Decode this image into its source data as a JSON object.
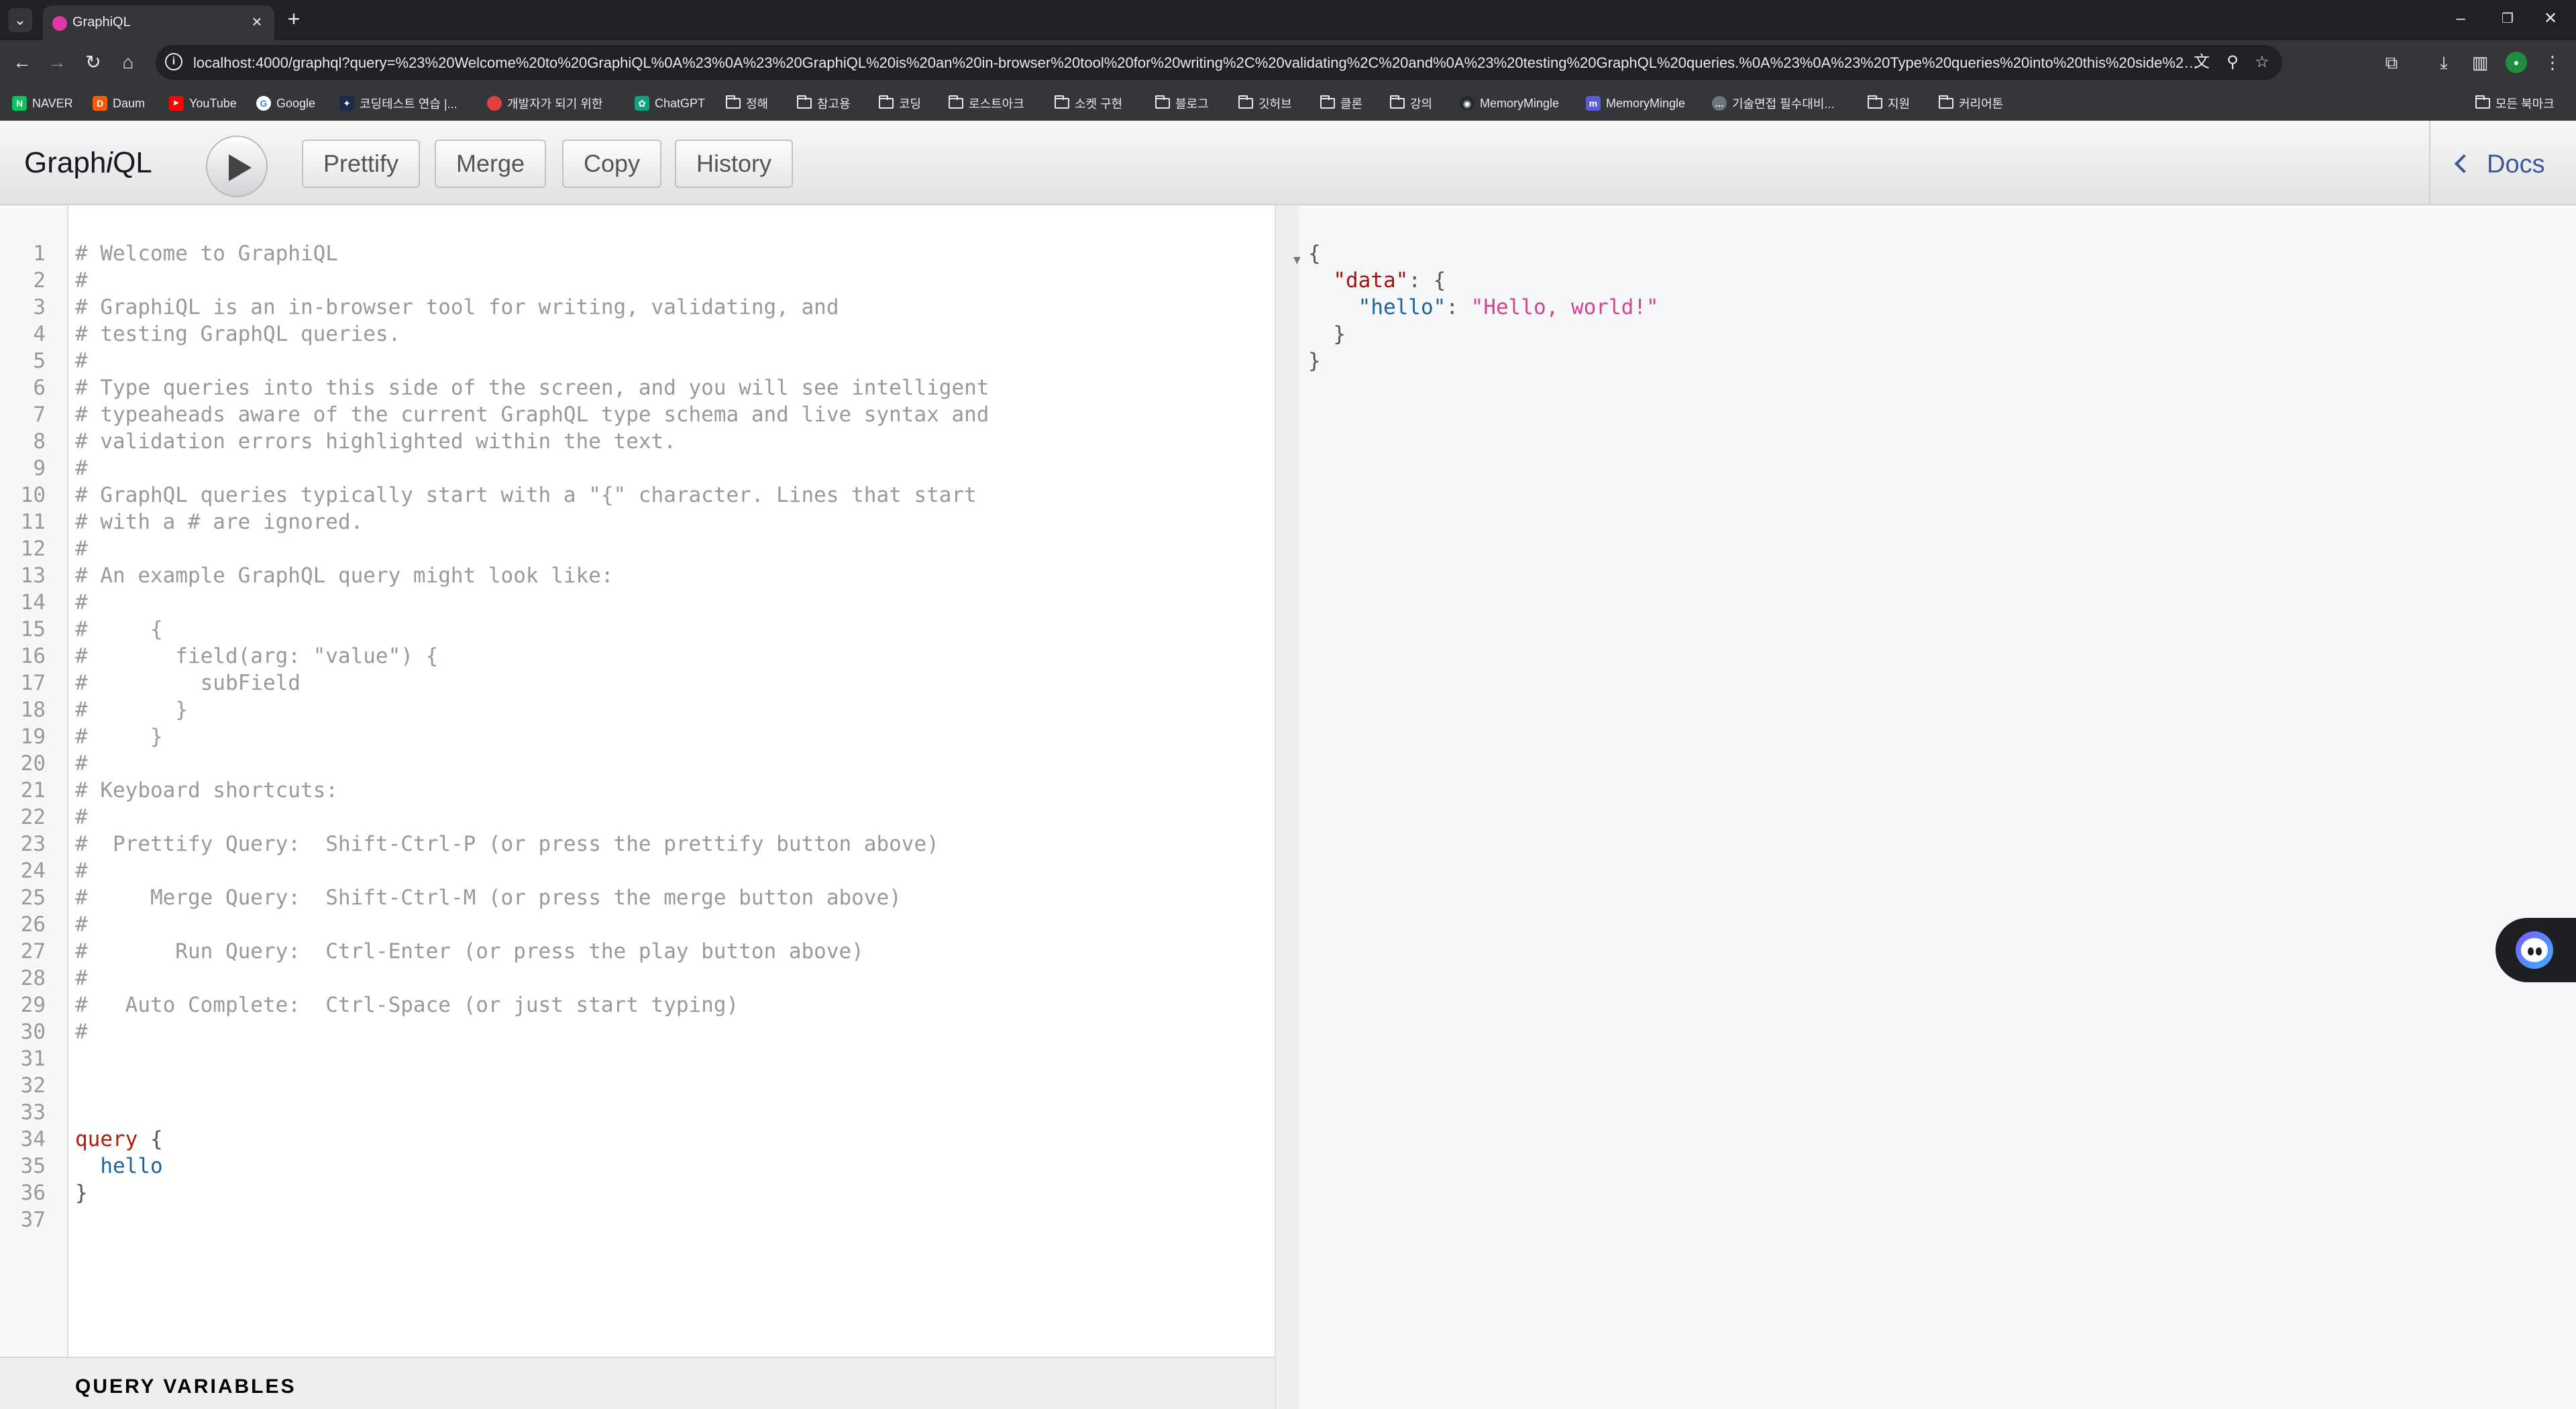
{
  "browser": {
    "tab": {
      "title": "GraphiQL"
    },
    "url": "localhost:4000/graphql?query=%23%20Welcome%20to%20GraphiQL%0A%23%0A%23%20GraphiQL%20is%20an%20in-browser%20tool%20for%20writing%2C%20validating%2C%20and%0A%23%20testing%20GraphQL%20queries.%0A%23%0A%23%20Type%20queries%20into%20this%20side%20of%20the%20screen%2C...",
    "bookmarks": [
      {
        "label": "NAVER",
        "icon": "naver-icon",
        "color": "#03c75a"
      },
      {
        "label": "Daum",
        "icon": "daum-icon",
        "color": "#ff5a00"
      },
      {
        "label": "YouTube",
        "icon": "youtube-icon",
        "color": "#ff0000"
      },
      {
        "label": "Google",
        "icon": "google-icon",
        "color": "#4285f4"
      },
      {
        "label": "코딩테스트 연습 |...",
        "icon": "programmers-icon",
        "color": "#1e2a4a"
      },
      {
        "label": "개발자가 되기 위한",
        "icon": "site-icon",
        "color": "#e04040"
      },
      {
        "label": "ChatGPT",
        "icon": "chatgpt-icon",
        "color": "#10a37f"
      },
      {
        "label": "정해",
        "icon": "folder-icon"
      },
      {
        "label": "참고용",
        "icon": "folder-icon"
      },
      {
        "label": "코딩",
        "icon": "folder-icon"
      },
      {
        "label": "로스트아크",
        "icon": "folder-icon"
      },
      {
        "label": "소켓 구현",
        "icon": "folder-icon"
      },
      {
        "label": "블로그",
        "icon": "folder-icon"
      },
      {
        "label": "깃허브",
        "icon": "folder-icon"
      },
      {
        "label": "클론",
        "icon": "folder-icon"
      },
      {
        "label": "강의",
        "icon": "folder-icon"
      },
      {
        "label": "MemoryMingle",
        "icon": "github-icon",
        "color": "#24292e"
      },
      {
        "label": "MemoryMingle",
        "icon": "site-icon",
        "color": "#5b5bd6"
      },
      {
        "label": "기술면접 필수대비...",
        "icon": "chat-icon",
        "color": "#6e7681"
      },
      {
        "label": "지원",
        "icon": "folder-icon"
      },
      {
        "label": "커리어톤",
        "icon": "folder-icon"
      }
    ],
    "all_bookmarks": "모든 북마크"
  },
  "graphiql": {
    "title_prefix": "Graph",
    "title_italic": "i",
    "title_suffix": "QL",
    "buttons": {
      "prettify": "Prettify",
      "merge": "Merge",
      "copy": "Copy",
      "history": "History"
    },
    "docs": "Docs",
    "query_variables": "QUERY VARIABLES",
    "editor_lines": [
      {
        "t": "# Welcome to GraphiQL",
        "k": "comment"
      },
      {
        "t": "#",
        "k": "comment"
      },
      {
        "t": "# GraphiQL is an in-browser tool for writing, validating, and",
        "k": "comment"
      },
      {
        "t": "# testing GraphQL queries.",
        "k": "comment"
      },
      {
        "t": "#",
        "k": "comment"
      },
      {
        "t": "# Type queries into this side of the screen, and you will see intelligent",
        "k": "comment"
      },
      {
        "t": "# typeaheads aware of the current GraphQL type schema and live syntax and",
        "k": "comment"
      },
      {
        "t": "# validation errors highlighted within the text.",
        "k": "comment"
      },
      {
        "t": "#",
        "k": "comment"
      },
      {
        "t": "# GraphQL queries typically start with a \"{\" character. Lines that start",
        "k": "comment"
      },
      {
        "t": "# with a # are ignored.",
        "k": "comment"
      },
      {
        "t": "#",
        "k": "comment"
      },
      {
        "t": "# An example GraphQL query might look like:",
        "k": "comment"
      },
      {
        "t": "#",
        "k": "comment"
      },
      {
        "t": "#     {",
        "k": "comment"
      },
      {
        "t": "#       field(arg: \"value\") {",
        "k": "comment"
      },
      {
        "t": "#         subField",
        "k": "comment"
      },
      {
        "t": "#       }",
        "k": "comment"
      },
      {
        "t": "#     }",
        "k": "comment"
      },
      {
        "t": "#",
        "k": "comment"
      },
      {
        "t": "# Keyboard shortcuts:",
        "k": "comment"
      },
      {
        "t": "#",
        "k": "comment"
      },
      {
        "t": "#  Prettify Query:  Shift-Ctrl-P (or press the prettify button above)",
        "k": "comment"
      },
      {
        "t": "#",
        "k": "comment"
      },
      {
        "t": "#     Merge Query:  Shift-Ctrl-M (or press the merge button above)",
        "k": "comment"
      },
      {
        "t": "#",
        "k": "comment"
      },
      {
        "t": "#       Run Query:  Ctrl-Enter (or press the play button above)",
        "k": "comment"
      },
      {
        "t": "#",
        "k": "comment"
      },
      {
        "t": "#   Auto Complete:  Ctrl-Space (or just start typing)",
        "k": "comment"
      },
      {
        "t": "#",
        "k": "comment"
      },
      {
        "t": "",
        "k": "plain"
      },
      {
        "t": "",
        "k": "plain"
      },
      {
        "t": "",
        "k": "plain"
      },
      {
        "t": "query {",
        "k": "query"
      },
      {
        "t": "  hello",
        "k": "field"
      },
      {
        "t": "}",
        "k": "punct"
      },
      {
        "t": "",
        "k": "plain"
      }
    ],
    "result": {
      "open_brace": "{",
      "data_key": "\"data\"",
      "hello_key": "\"hello\"",
      "hello_value": "\"Hello, world!\"",
      "inner_close": "}",
      "close_brace": "}"
    }
  }
}
